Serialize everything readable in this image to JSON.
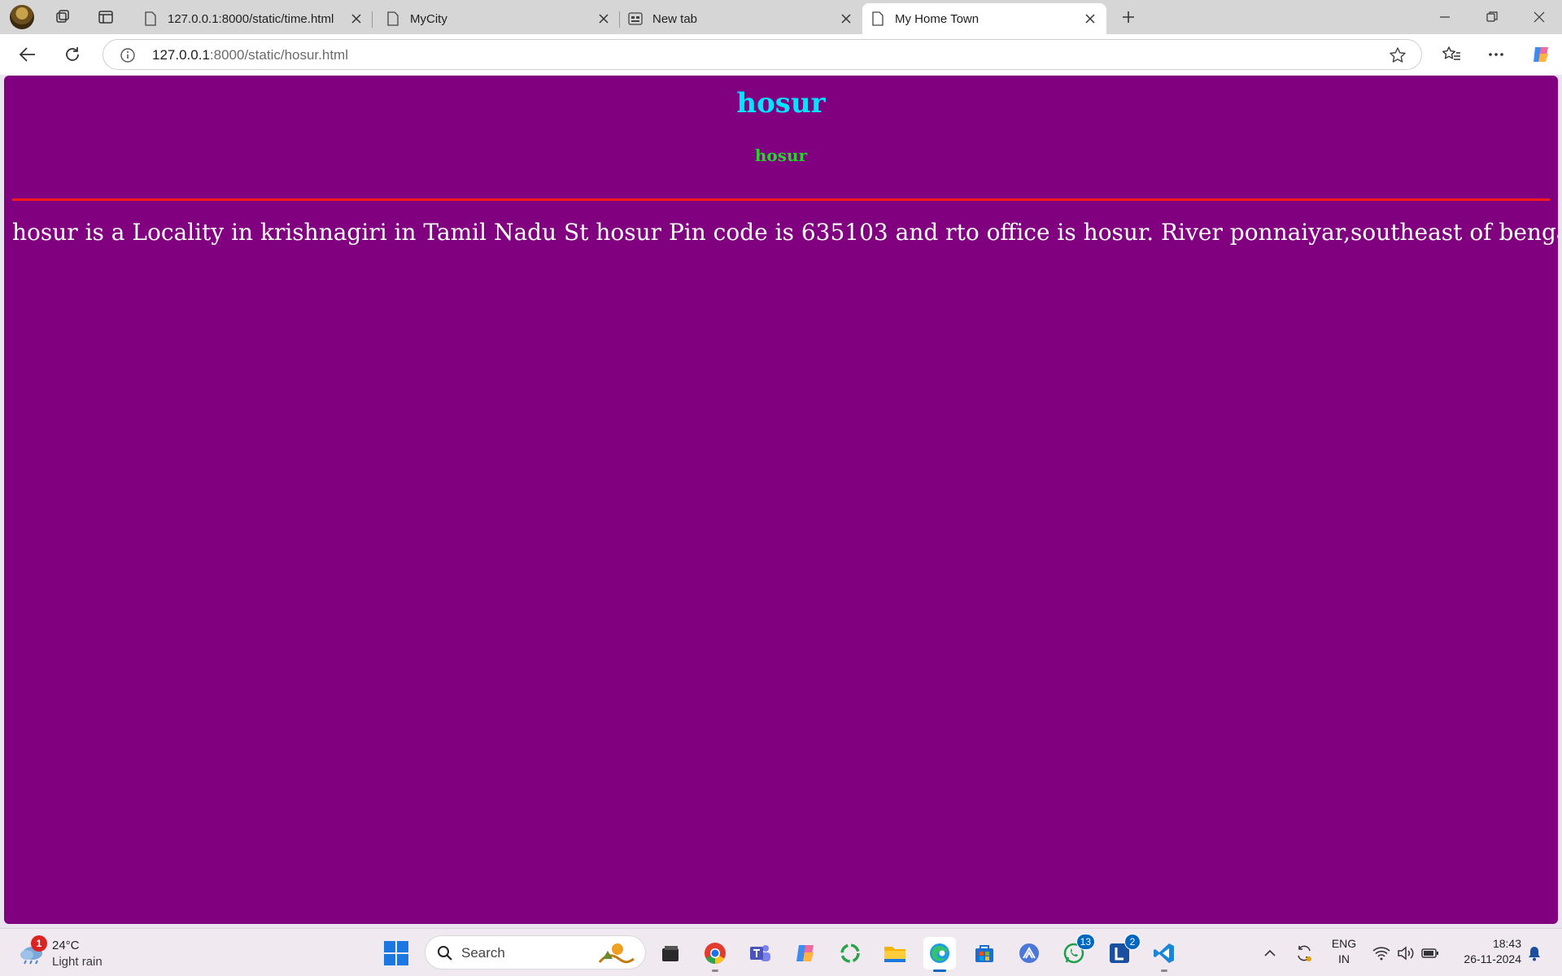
{
  "browser": {
    "tabs": [
      {
        "title": "127.0.0.1:8000/static/time.html",
        "icon": "page-icon"
      },
      {
        "title": "MyCity",
        "icon": "page-icon"
      },
      {
        "title": "New tab",
        "icon": "newtab-icon"
      },
      {
        "title": "My Home Town",
        "icon": "page-icon",
        "active": true
      }
    ],
    "address": {
      "host": "127.0.0.1",
      "rest": ":8000/static/hosur.html"
    }
  },
  "page": {
    "background": "#800080",
    "heading": "hosur",
    "subheading": "hosur",
    "paragraph": "hosur is a Locality in krishnagiri in Tamil Nadu St hosur Pin code is 635103 and rto office is hosur. River ponnaiyar,southeast of bengalur",
    "colors": {
      "heading": "#00e5ff",
      "subheading": "#22d62a",
      "rule": "#ff1a1a",
      "text": "#ffffff"
    }
  },
  "taskbar": {
    "weather": {
      "temp": "24°C",
      "condition": "Light rain",
      "badge": "1"
    },
    "search_placeholder": "Search",
    "apps": [
      {
        "name": "file-explorer-dark"
      },
      {
        "name": "chrome"
      },
      {
        "name": "teams"
      },
      {
        "name": "copilot"
      },
      {
        "name": "refresh-app"
      },
      {
        "name": "file-explorer"
      },
      {
        "name": "edge",
        "active": true
      },
      {
        "name": "store"
      },
      {
        "name": "vpn-app"
      },
      {
        "name": "whatsapp",
        "badge": "13"
      },
      {
        "name": "l-app",
        "badge": "2"
      },
      {
        "name": "vscode"
      }
    ],
    "tray": {
      "lang_top": "ENG",
      "lang_bottom": "IN",
      "time": "18:43",
      "date": "26-11-2024"
    }
  }
}
